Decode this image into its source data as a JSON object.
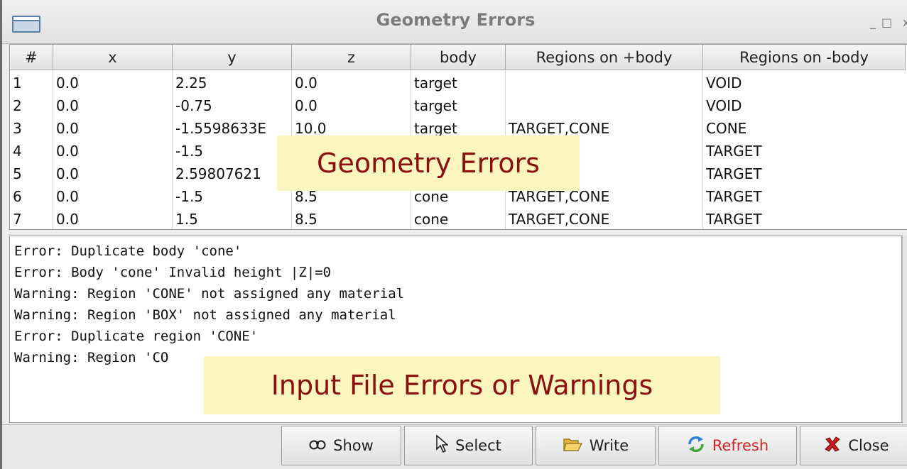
{
  "window": {
    "title": "Geometry Errors",
    "controls": {
      "minimize": "_",
      "maximize": "□",
      "close": "x"
    }
  },
  "table": {
    "columns": [
      "#",
      "x",
      "y",
      "z",
      "body",
      "Regions on +body",
      "Regions on -body"
    ],
    "rows": [
      [
        "1",
        "0.0",
        "2.25",
        "0.0",
        "target",
        "",
        "VOID"
      ],
      [
        "2",
        "0.0",
        "-0.75",
        "0.0",
        "target",
        "",
        "VOID"
      ],
      [
        "3",
        "0.0",
        "-1.5598633E",
        "10.0",
        "target",
        "TARGET,CONE",
        "CONE"
      ],
      [
        "4",
        "0.0",
        "-1.5",
        "",
        "",
        "",
        "TARGET"
      ],
      [
        "5",
        "0.0",
        "2.59807621",
        "",
        "",
        "",
        "TARGET"
      ],
      [
        "6",
        "0.0",
        "-1.5",
        "8.5",
        "cone",
        "TARGET,CONE",
        "TARGET"
      ],
      [
        "7",
        "0.0",
        "1.5",
        "8.5",
        "cone",
        "TARGET,CONE",
        "TARGET"
      ]
    ]
  },
  "log": {
    "lines": [
      "Error: Duplicate body 'cone'",
      "Error: Body 'cone' Invalid height |Z|=0",
      "Warning: Region 'CONE' not assigned any material",
      "Warning: Region 'BOX' not assigned any material",
      "Error: Duplicate region 'CONE'",
      "Warning: Region 'CO"
    ]
  },
  "toolbar": {
    "show_label": "Show",
    "select_label": "Select",
    "write_label": "Write",
    "refresh_label": "Refresh",
    "close_label": "Close"
  },
  "callouts": {
    "table": "Geometry Errors",
    "log": "Input File Errors or Warnings"
  },
  "colors": {
    "callout_bg": "#fbf5c0",
    "callout_text": "#8b0f0f",
    "refresh_text": "#d22222"
  }
}
